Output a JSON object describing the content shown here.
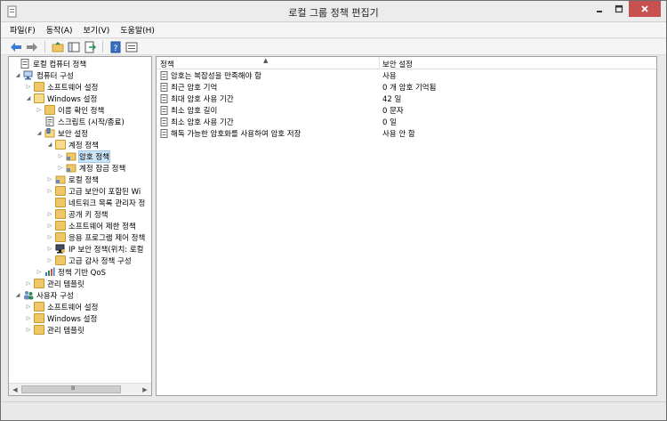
{
  "window": {
    "title": "로컬 그룹 정책 편집기"
  },
  "menu": [
    "파일(F)",
    "동작(A)",
    "보기(V)",
    "도움말(H)"
  ],
  "toolbar": {
    "icons": [
      "back-arrow-icon",
      "forward-arrow-icon",
      "up-folder-icon",
      "show-hide-tree-icon",
      "export-list-icon",
      "help-icon",
      "properties-icon"
    ]
  },
  "tree": {
    "root": "로컬 컴퓨터 정책",
    "computer_config": "컴퓨터 구성",
    "cc_software": "소프트웨어 설정",
    "cc_windows": "Windows 설정",
    "name_resolution": "이름 확인 정책",
    "scripts": "스크립트 (시작/종료)",
    "security_settings": "보안 설정",
    "account_policies": "계정 정책",
    "password_policy": "암호 정책",
    "account_lockout": "계정 잠금 정책",
    "local_policies": "로컬 정책",
    "advanced_firewall": "고급 보안이 포함된 Wi",
    "network_list": "네트워크 목록 관리자 정",
    "public_key": "공개 키 정책",
    "software_restriction": "소프트웨어 제한 정책",
    "app_control": "응용 프로그램 제어 정책",
    "ipsec": "IP 보안 정책(위치: 로컬",
    "advanced_audit": "고급 감사 정책 구성",
    "qos": "정책 기반 QoS",
    "cc_admin_templates": "관리 템플릿",
    "user_config": "사용자 구성",
    "uc_software": "소프트웨어 설정",
    "uc_windows": "Windows 설정",
    "uc_admin_templates": "관리 템플릿"
  },
  "list": {
    "col_policy": "정책",
    "col_setting": "보안 설정",
    "rows": [
      {
        "name": "암호는 복잡성을 만족해야 함",
        "value": "사용"
      },
      {
        "name": "최근 암호 기억",
        "value": "0 개 암호 기억됨"
      },
      {
        "name": "최대 암호 사용 기간",
        "value": "42 일"
      },
      {
        "name": "최소 암호 길이",
        "value": "0 문자"
      },
      {
        "name": "최소 암호 사용 기간",
        "value": "0 일"
      },
      {
        "name": "해독 가능한 암호화를 사용하여 암호 저장",
        "value": "사용 안 함"
      }
    ]
  },
  "colors": {
    "close_button": "#c75050",
    "selection": "#cce4f7",
    "folder": "#efc769"
  }
}
